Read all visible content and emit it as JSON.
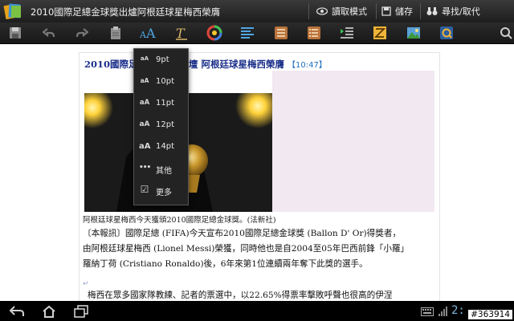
{
  "titlebar": {
    "title": "2010國際足總金球獎出爐阿根廷球星梅西榮膺",
    "reading_mode": "讀取模式",
    "save": "儲存",
    "find_replace": "尋找/取代"
  },
  "toolbar": {
    "tools": [
      "save-icon",
      "undo-icon",
      "redo-icon",
      "paste-icon",
      "font-size-icon",
      "font-style-icon",
      "font-color-icon",
      "align-icon",
      "list-icon",
      "numbered-list-icon",
      "indent-icon",
      "columns-icon",
      "insert-image-icon",
      "insert-link-icon",
      "search-icon"
    ]
  },
  "document": {
    "headline": "2010國際足球",
    "headline_tail": "壇 阿根廷球星梅西榮膺",
    "time": "【10:47】",
    "caption": "阿根廷球星梅西今天獲頒2010國際足總金球獎。(法新社)",
    "para1_line1": "〔本報訊〕國際足總 (FIFA)今天宣布2010國際足總金球獎 (Ballon D' Or)得獎者，",
    "para1_line2": "由阿根廷球星梅西 (Lionel Messi)榮獲，同時他也是自2004至05年巴西前鋒「小羅」",
    "para1_line3": "羅納丁荷 (Cristiano Ronaldo)後，6年來第1位連續兩年奪下此獎的選手。",
    "mark": "↵",
    "para2_line1": "梅西在眾多國家隊教練、記者的票選中，以22.65%得票率擊敗呼聲也很高的伊涅"
  },
  "popup": {
    "items": [
      {
        "icon": "aA",
        "label": "9pt"
      },
      {
        "icon": "aA",
        "label": "10pt"
      },
      {
        "icon": "aA",
        "label": "11pt"
      },
      {
        "icon": "aA",
        "label": "12pt"
      },
      {
        "icon": "aA",
        "label": "14pt"
      },
      {
        "icon": "•••",
        "label": "其他"
      },
      {
        "icon": "☑",
        "label": "更多"
      }
    ]
  },
  "systembar": {
    "clock": "2:",
    "watermark": "#363914"
  },
  "colors": {
    "headline": "#1b2f8a",
    "time": "#1f6fbd",
    "accent": "#3aa6e0"
  }
}
